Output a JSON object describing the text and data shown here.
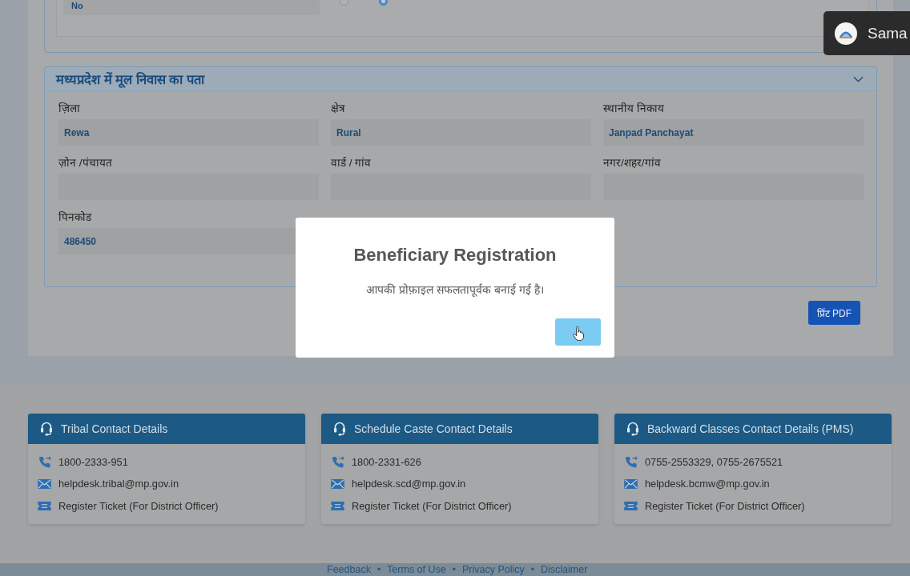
{
  "top_section": {
    "field_value": "No",
    "radios": [
      {
        "selected": false
      },
      {
        "selected": true
      }
    ]
  },
  "toast": {
    "text": "Sama"
  },
  "address_section": {
    "title": "मध्यप्रदेश में मूल निवास का पता",
    "expanded": true,
    "fields": [
      {
        "label": "ज़िला",
        "value": "Rewa"
      },
      {
        "label": "क्षेत्र",
        "value": "Rural"
      },
      {
        "label": "स्थानीय निकाय",
        "value": "Janpad Panchayat"
      },
      {
        "label": "ज़ोन /पंचायत"
      },
      {
        "label": "वार्ड / गांव"
      },
      {
        "label": "नगर/शहर/गांव"
      },
      {
        "label": "पिनकोड",
        "value": "486450"
      }
    ]
  },
  "print_button": {
    "label": "प्रिंट PDF"
  },
  "dialog": {
    "title": "Beneficiary Registration",
    "message": "आपकी प्रोफ़ाइल सफलतापूर्वक बनाई गई है।"
  },
  "contacts": [
    {
      "title": "Tribal Contact Details",
      "phone": "1800-2333-951",
      "email": "helpdesk.tribal@mp.gov.in",
      "ticket": "Register Ticket (For District Officer)"
    },
    {
      "title": "Schedule Caste Contact Details",
      "phone": "1800-2331-626",
      "email": "helpdesk.scd@mp.gov.in",
      "ticket": "Register Ticket (For District Officer)"
    },
    {
      "title": "Backward Classes Contact Details (PMS)",
      "phone": "0755-2553329, 0755-2675521",
      "email": "helpdesk.bcmw@mp.gov.in",
      "ticket": "Register Ticket (For District Officer)"
    }
  ],
  "footer": {
    "separator": "•",
    "links": [
      "Feedback",
      "Terms of Use",
      "Privacy Policy",
      "Disclaimer"
    ]
  }
}
